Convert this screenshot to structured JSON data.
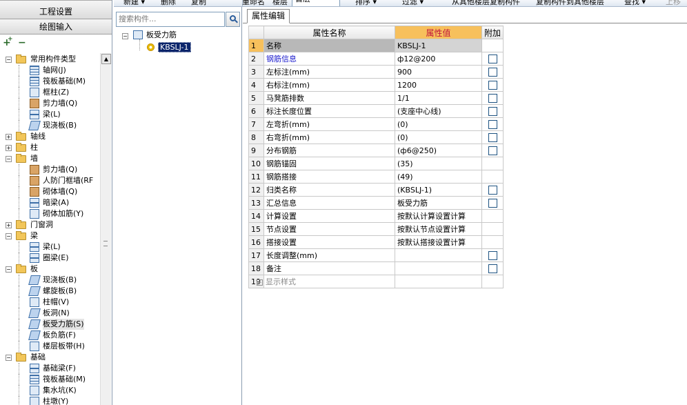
{
  "toolbar": {
    "new_label": "新建 ▾",
    "delete_label": "删除",
    "copy_label": "复制",
    "rename_label": "重命名",
    "floor_label": "楼层",
    "floor_value": "首层",
    "sort_label": "排序 ▾",
    "filter_label": "过滤 ▾",
    "copy_from_label": "从其他楼层复制构件",
    "copy_to_label": "复制构件到其他楼层",
    "find_label": "查找 ▾",
    "up_label": "上移"
  },
  "nav": {
    "project_settings": "工程设置",
    "drawing_input": "绘图输入",
    "tree": [
      {
        "label": "常用构件类型",
        "level": 0,
        "kind": "folder",
        "expanded": true
      },
      {
        "label": "轴网(J)",
        "level": 1,
        "icon": "axis-grid-icon"
      },
      {
        "label": "筏板基础(M)",
        "level": 1,
        "icon": "raft-foundation-icon"
      },
      {
        "label": "框柱(Z)",
        "level": 1,
        "icon": "frame-column-icon"
      },
      {
        "label": "剪力墙(Q)",
        "level": 1,
        "icon": "shear-wall-icon"
      },
      {
        "label": "梁(L)",
        "level": 1,
        "icon": "beam-icon"
      },
      {
        "label": "现浇板(B)",
        "level": 1,
        "icon": "cast-slab-icon"
      },
      {
        "label": "轴线",
        "level": 0,
        "kind": "folder",
        "expanded": false
      },
      {
        "label": "柱",
        "level": 0,
        "kind": "folder",
        "expanded": false
      },
      {
        "label": "墙",
        "level": 0,
        "kind": "folder",
        "expanded": true
      },
      {
        "label": "剪力墙(Q)",
        "level": 1,
        "icon": "shear-wall-icon"
      },
      {
        "label": "人防门框墙(RF",
        "level": 1,
        "icon": "civil-defense-door-wall-icon"
      },
      {
        "label": "砌体墙(Q)",
        "level": 1,
        "icon": "masonry-wall-icon"
      },
      {
        "label": "暗梁(A)",
        "level": 1,
        "icon": "hidden-beam-icon"
      },
      {
        "label": "砌体加筋(Y)",
        "level": 1,
        "icon": "masonry-rebar-icon"
      },
      {
        "label": "门窗洞",
        "level": 0,
        "kind": "folder",
        "expanded": false
      },
      {
        "label": "梁",
        "level": 0,
        "kind": "folder",
        "expanded": true
      },
      {
        "label": "梁(L)",
        "level": 1,
        "icon": "beam-icon"
      },
      {
        "label": "圈梁(E)",
        "level": 1,
        "icon": "ring-beam-icon"
      },
      {
        "label": "板",
        "level": 0,
        "kind": "folder",
        "expanded": true
      },
      {
        "label": "现浇板(B)",
        "level": 1,
        "icon": "cast-slab-icon"
      },
      {
        "label": "螺旋板(B)",
        "level": 1,
        "icon": "spiral-slab-icon"
      },
      {
        "label": "柱帽(V)",
        "level": 1,
        "icon": "column-cap-icon"
      },
      {
        "label": "板洞(N)",
        "level": 1,
        "icon": "slab-hole-icon"
      },
      {
        "label": "板受力筋(S)",
        "level": 1,
        "icon": "slab-rebar-icon",
        "selected": true
      },
      {
        "label": "板负筋(F)",
        "level": 1,
        "icon": "slab-negative-rebar-icon"
      },
      {
        "label": "楼层板带(H)",
        "level": 1,
        "icon": "floor-strip-icon"
      },
      {
        "label": "基础",
        "level": 0,
        "kind": "folder",
        "expanded": true
      },
      {
        "label": "基础梁(F)",
        "level": 1,
        "icon": "foundation-beam-icon"
      },
      {
        "label": "筏板基础(M)",
        "level": 1,
        "icon": "raft-foundation-icon"
      },
      {
        "label": "集水坑(K)",
        "level": 1,
        "icon": "sump-pit-icon"
      },
      {
        "label": "柱墩(Y)",
        "level": 1,
        "icon": "column-pier-icon"
      }
    ]
  },
  "components": {
    "search_placeholder": "搜索构件...",
    "root_label": "板受力筋",
    "item_label": "KBSLJ-1"
  },
  "properties": {
    "tab_label": "属性编辑",
    "col_name": "属性名称",
    "col_value": "属性值",
    "col_extra": "附加",
    "rows": [
      {
        "num": "1",
        "name": "名称",
        "value": "KBSLJ-1",
        "checkbox": false,
        "selected": true
      },
      {
        "num": "2",
        "name": "钢筋信息",
        "value": "ф12@200",
        "checkbox": true,
        "blue": true
      },
      {
        "num": "3",
        "name": "左标注(mm)",
        "value": "900",
        "checkbox": true
      },
      {
        "num": "4",
        "name": "右标注(mm)",
        "value": "1200",
        "checkbox": true
      },
      {
        "num": "5",
        "name": "马凳筋排数",
        "value": "1/1",
        "checkbox": true
      },
      {
        "num": "6",
        "name": "标注长度位置",
        "value": "(支座中心线)",
        "checkbox": true
      },
      {
        "num": "7",
        "name": "左弯折(mm)",
        "value": "(0)",
        "checkbox": true
      },
      {
        "num": "8",
        "name": "右弯折(mm)",
        "value": "(0)",
        "checkbox": true
      },
      {
        "num": "9",
        "name": "分布钢筋",
        "value": "(ф6@250)",
        "checkbox": true
      },
      {
        "num": "10",
        "name": "钢筋锚固",
        "value": "(35)",
        "checkbox": false
      },
      {
        "num": "11",
        "name": "钢筋搭接",
        "value": "(49)",
        "checkbox": false
      },
      {
        "num": "12",
        "name": "归类名称",
        "value": "(KBSLJ-1)",
        "checkbox": true
      },
      {
        "num": "13",
        "name": "汇总信息",
        "value": "板受力筋",
        "checkbox": true
      },
      {
        "num": "14",
        "name": "计算设置",
        "value": "按默认计算设置计算",
        "checkbox": false
      },
      {
        "num": "15",
        "name": "节点设置",
        "value": "按默认节点设置计算",
        "checkbox": false
      },
      {
        "num": "16",
        "name": "搭接设置",
        "value": "按默认搭接设置计算",
        "checkbox": false
      },
      {
        "num": "17",
        "name": "长度调整(mm)",
        "value": "",
        "checkbox": true
      },
      {
        "num": "18",
        "name": "备注",
        "value": "",
        "checkbox": true
      },
      {
        "num": "19",
        "name": "显示样式",
        "value": "",
        "checkbox": false,
        "expandable": true,
        "grey": true
      }
    ]
  }
}
